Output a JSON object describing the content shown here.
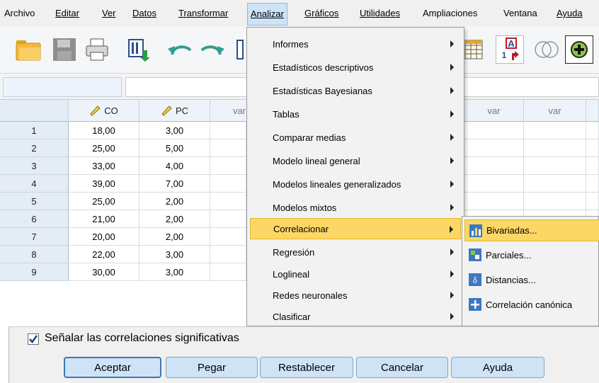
{
  "menubar": {
    "items": [
      "Archivo",
      "Editar",
      "Ver",
      "Datos",
      "Transformar",
      "Analizar",
      "Gráficos",
      "Utilidades",
      "Ampliaciones",
      "Ventana",
      "Ayuda"
    ]
  },
  "toolbar": {
    "icons": [
      "open-folder-icon",
      "save-icon",
      "print-icon",
      "recall-dialog-icon",
      "undo-icon",
      "redo-icon",
      "go-to-case-icon",
      "split-file-icon",
      "value-labels-icon",
      "use-sets-icon",
      "add-on-icon"
    ],
    "value_labels_letter": "A",
    "value_labels_number": "1"
  },
  "grid": {
    "columns": [
      "CO",
      "PC",
      "var",
      "var",
      "var"
    ],
    "rows": [
      {
        "n": "1",
        "co": "18,00",
        "pc": "3,00"
      },
      {
        "n": "2",
        "co": "25,00",
        "pc": "5,00"
      },
      {
        "n": "3",
        "co": "33,00",
        "pc": "4,00"
      },
      {
        "n": "4",
        "co": "39,00",
        "pc": "7,00"
      },
      {
        "n": "5",
        "co": "25,00",
        "pc": "2,00"
      },
      {
        "n": "6",
        "co": "21,00",
        "pc": "2,00"
      },
      {
        "n": "7",
        "co": "20,00",
        "pc": "2,00"
      },
      {
        "n": "8",
        "co": "22,00",
        "pc": "3,00"
      },
      {
        "n": "9",
        "co": "30,00",
        "pc": "3,00"
      }
    ]
  },
  "analyze_menu": {
    "items": [
      "Informes",
      "Estadísticos descriptivos",
      "Estadísticas Bayesianas",
      "Tablas",
      "Comparar medias",
      "Modelo lineal general",
      "Modelos lineales generalizados",
      "Modelos mixtos",
      "Correlacionar",
      "Regresión",
      "Loglineal",
      "Redes neuronales",
      "Clasificar"
    ],
    "highlighted": "Correlacionar"
  },
  "correlate_submenu": {
    "items": [
      "Bivariadas...",
      "Parciales...",
      "Distancias...",
      "Correlación canónica"
    ],
    "highlighted": "Bivariadas..."
  },
  "dialog": {
    "checkbox_label": "Señalar las correlaciones significativas",
    "checkbox_checked": true,
    "buttons": [
      "Aceptar",
      "Pegar",
      "Restablecer",
      "Cancelar",
      "Ayuda"
    ]
  },
  "colors": {
    "highlight": "#fcd765",
    "menu_active": "#cde3f7",
    "button": "#cfe3f7"
  }
}
